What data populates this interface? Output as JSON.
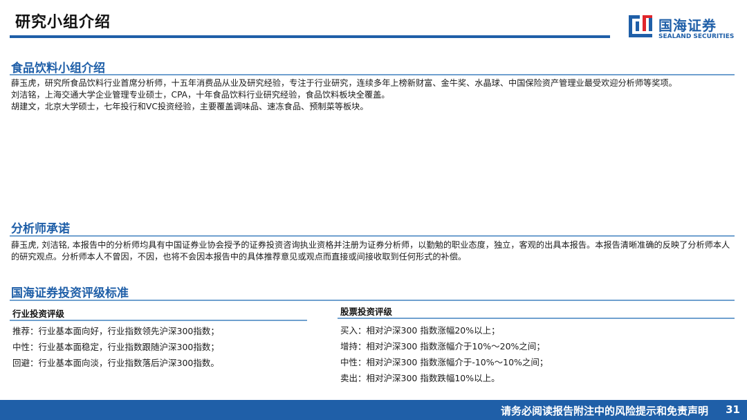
{
  "header": {
    "page_title": "研究小组介绍",
    "logo_cn": "国海证券",
    "logo_en": "SEALAND SECURITIES"
  },
  "team": {
    "title": "食品饮料小组介绍",
    "members": [
      "薛玉虎，研究所食品饮料行业首席分析师，十五年消费品从业及研究经验，专注于行业研究，连续多年上榜新财富、金牛奖、水晶球、中国保险资产管理业最受欢迎分析师等奖项。",
      "刘洁铭，上海交通大学企业管理专业硕士，CPA，十年食品饮料行业研究经验，食品饮料板块全覆盖。",
      "胡建文，北京大学硕士，七年投行和VC投资经验，主要覆盖调味品、速冻食品、预制菜等板块。"
    ]
  },
  "commitment": {
    "title": "分析师承诺",
    "text": "薛玉虎, 刘洁铭, 本报告中的分析师均具有中国证券业协会授予的证券投资咨询执业资格并注册为证券分析师，以勤勉的职业态度，独立，客观的出具本报告。本报告清晰准确的反映了分析师本人的研究观点。分析师本人不曾因，不因，也将不会因本报告中的具体推荐意见或观点而直接或间接收取到任何形式的补偿。"
  },
  "rating": {
    "title": "国海证券投资评级标准",
    "industry": {
      "heading": "行业投资评级",
      "items": [
        "推荐：行业基本面向好，行业指数领先沪深300指数；",
        "中性：行业基本面稳定，行业指数跟随沪深300指数；",
        "回避：行业基本面向淡，行业指数落后沪深300指数。"
      ]
    },
    "stock": {
      "heading": "股票投资评级",
      "items": [
        "买入：相对沪深300 指数涨幅20%以上；",
        "增持：相对沪深300 指数涨幅介于10%～20%之间；",
        "中性：相对沪深300 指数涨幅介于-10%～10%之间；",
        "卖出：相对沪深300 指数跌幅10%以上。"
      ]
    }
  },
  "footer": {
    "disclaimer": "请务必阅读报告附注中的风险提示和免责声明",
    "page_number": "31"
  },
  "colors": {
    "brand_blue": "#1f5fa8",
    "rule_blue": "#6fa0cf",
    "logo_red": "#e0262b"
  }
}
